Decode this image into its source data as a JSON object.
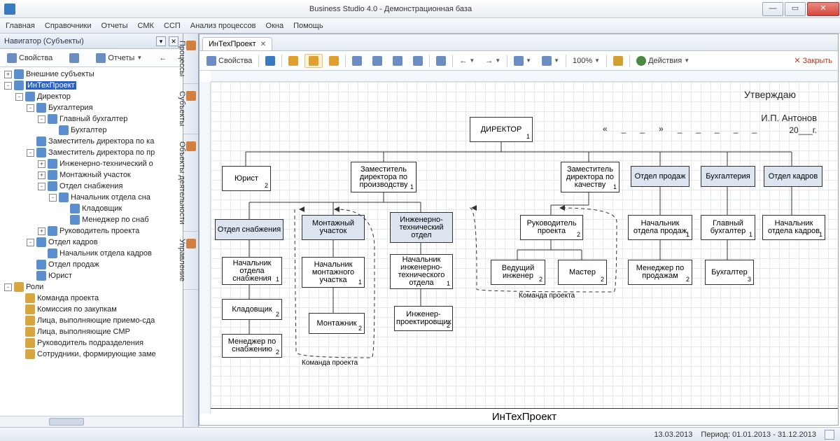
{
  "window": {
    "title": "Business Studio 4.0 - Демонстрационная база"
  },
  "menu": [
    "Главная",
    "Справочники",
    "Отчеты",
    "СМК",
    "ССП",
    "Анализ процессов",
    "Окна",
    "Помощь"
  ],
  "nav": {
    "title": "Навигатор (Субъекты)",
    "tool_props": "Свойства",
    "tool_reports": "Отчеты"
  },
  "tree": [
    {
      "d": 0,
      "e": "+",
      "ic": "p",
      "t": "Внешние субъекты"
    },
    {
      "d": 0,
      "e": "-",
      "ic": "p",
      "t": "ИнТехПроект",
      "sel": true
    },
    {
      "d": 1,
      "e": "-",
      "ic": "p",
      "t": "Директор"
    },
    {
      "d": 2,
      "e": "-",
      "ic": "p",
      "t": "Бухгалтерия"
    },
    {
      "d": 3,
      "e": "-",
      "ic": "p",
      "t": "Главный бухгалтер"
    },
    {
      "d": 4,
      "e": "",
      "ic": "p",
      "t": "Бухгалтер"
    },
    {
      "d": 2,
      "e": "",
      "ic": "p",
      "t": "Заместитель директора по ка"
    },
    {
      "d": 2,
      "e": "-",
      "ic": "p",
      "t": "Заместитель директора по пр"
    },
    {
      "d": 3,
      "e": "+",
      "ic": "p",
      "t": "Инженерно-технический о"
    },
    {
      "d": 3,
      "e": "+",
      "ic": "p",
      "t": "Монтажный участок"
    },
    {
      "d": 3,
      "e": "-",
      "ic": "p",
      "t": "Отдел снабжения"
    },
    {
      "d": 4,
      "e": "-",
      "ic": "p",
      "t": "Начальник отдела сна"
    },
    {
      "d": 5,
      "e": "",
      "ic": "p",
      "t": "Кладовщик"
    },
    {
      "d": 5,
      "e": "",
      "ic": "p",
      "t": "Менеджер по снаб"
    },
    {
      "d": 3,
      "e": "+",
      "ic": "p",
      "t": "Руководитель проекта"
    },
    {
      "d": 2,
      "e": "-",
      "ic": "p",
      "t": "Отдел кадров"
    },
    {
      "d": 3,
      "e": "",
      "ic": "p",
      "t": "Начальник отдела кадров"
    },
    {
      "d": 2,
      "e": "",
      "ic": "p",
      "t": "Отдел продаж"
    },
    {
      "d": 2,
      "e": "",
      "ic": "p",
      "t": "Юрист"
    },
    {
      "d": 0,
      "e": "-",
      "ic": "r",
      "t": "Роли"
    },
    {
      "d": 1,
      "e": "",
      "ic": "r",
      "t": "Команда проекта"
    },
    {
      "d": 1,
      "e": "",
      "ic": "r",
      "t": "Комиссия по закупкам"
    },
    {
      "d": 1,
      "e": "",
      "ic": "r",
      "t": "Лица, выполняющие приемо-сда"
    },
    {
      "d": 1,
      "e": "",
      "ic": "r",
      "t": "Лица, выполняющие СМР"
    },
    {
      "d": 1,
      "e": "",
      "ic": "r",
      "t": "Руководитель подразделения"
    },
    {
      "d": 1,
      "e": "",
      "ic": "r",
      "t": "Сотрудники, формирующие заме"
    }
  ],
  "sidetabs": [
    "Процессы",
    "Субъекты",
    "Объекты деятельности",
    "Управление"
  ],
  "doc": {
    "tab": "ИнТехПроект",
    "props": "Свойства",
    "zoom": "100%",
    "actions": "Действия",
    "close": "Закрыть",
    "approve": "Утверждаю",
    "signer": "И.П. Антонов",
    "year_prefix": "20___г.",
    "footer": "ИнТехПроект",
    "team": "Команда проекта"
  },
  "boxes": {
    "director": "ДИРЕКТОР",
    "jurist": "Юрист",
    "zam_prod": "Заместитель директора по производству",
    "zam_qual": "Заместитель директора по качеству",
    "sales": "Отдел продаж",
    "accounting": "Бухгалтерия",
    "hr": "Отдел кадров",
    "supply": "Отдел снабжения",
    "assembly": "Монтажный участок",
    "engdept": "Инженерно-технический отдел",
    "projlead": "Руководитель проекта",
    "saleshead": "Начальник отдела продаж",
    "mainacc": "Главный бухгалтер",
    "hrhead": "Начальник отдела кадров",
    "supplyhead": "Начальник отдела снабжения",
    "assemblyhead": "Начальник монтажного участка",
    "enghead": "Начальник инженерно-технического отдела",
    "leadeng": "Ведущий инженер",
    "master": "Мастер",
    "salesmgr": "Менеджер по продажам",
    "accountant": "Бухгалтер",
    "storekeeper": "Кладовщик",
    "assembler": "Монтажник",
    "designer": "Инженер-проектировщик",
    "supplymgr": "Менеджер по снабжению"
  },
  "status": {
    "date": "13.03.2013",
    "period": "Период: 01.01.2013 - 31.12.2013"
  }
}
